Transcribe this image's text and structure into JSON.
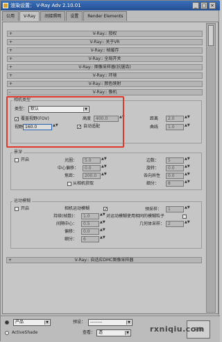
{
  "window": {
    "title": "渲染设置： V-Ray Adv 2.10.01",
    "min": "_",
    "max": "□",
    "close": "×"
  },
  "tabs": [
    "公用",
    "V-Ray",
    "间接照明",
    "设置",
    "Render Elements"
  ],
  "rollouts_top": [
    "V-Ray:: 授权",
    "V-Ray:: 关于VR",
    "V-Ray:: 帧缓存",
    "V-Ray:: 全局开关",
    "V-Ray:: 图像采样器(抗锯齿)",
    "V-Ray:: 环境",
    "V-Ray:: 颜色映射",
    "V-Ray:: 像机"
  ],
  "camera_type": {
    "group": "相机类型",
    "type_label": "类型：",
    "type_value": "默认",
    "override_fov": "覆盖视野(FOV)",
    "height_label": "高度",
    "height_value": "400.0",
    "fov_label": "视野",
    "fov_value": "160.0",
    "auto_fit": "自动适配",
    "dist_label": "距离",
    "dist_value": "2.0",
    "curve_label": "曲线",
    "curve_value": "1.0"
  },
  "dof": {
    "group": "景深",
    "on": "开启",
    "aperture_label": "光圈：",
    "aperture_value": "5.0",
    "center_bias_label": "中心偏移：",
    "center_bias_value": "0.0",
    "focal_label": "焦距：",
    "focal_value": "200.0",
    "from_camera": "从相机获取",
    "sides_label": "边数：",
    "sides_value": "5",
    "rotation_label": "旋转：",
    "rotation_value": "0.0",
    "aniso_label": "各向异性",
    "aniso_value": "0.0",
    "subdivs_label": "细分：",
    "subdivs_value": "8"
  },
  "motion_blur": {
    "group": "运动模糊",
    "on": "开启",
    "cam_motion": "相机运动模糊",
    "duration_label": "持续(帧数)：",
    "duration_value": "1.0",
    "interval_center_label": "间隔中心：",
    "interval_center_value": "0.5",
    "bias_label": "偏移：",
    "bias_value": "0.0",
    "subdivs_label": "细分：",
    "subdivs_value": "6",
    "prepass_label": "预采样：",
    "prepass_value": "1",
    "blur_particles": "对运动模糊使用相同的模糊粒子",
    "geom_samples_label": "几何体采样：",
    "geom_samples_value": "2"
  },
  "rollout_bottom": "V-Ray:: 自适应DMC图像采样器",
  "footer": {
    "product_value": "产品",
    "preset_label": "预设：",
    "preset_value": "--------",
    "activeshade": "ActiveShade",
    "view_label": "查看：",
    "view_value": "透",
    "render_button": "渲染"
  },
  "watermark": "rxniqiu.com"
}
